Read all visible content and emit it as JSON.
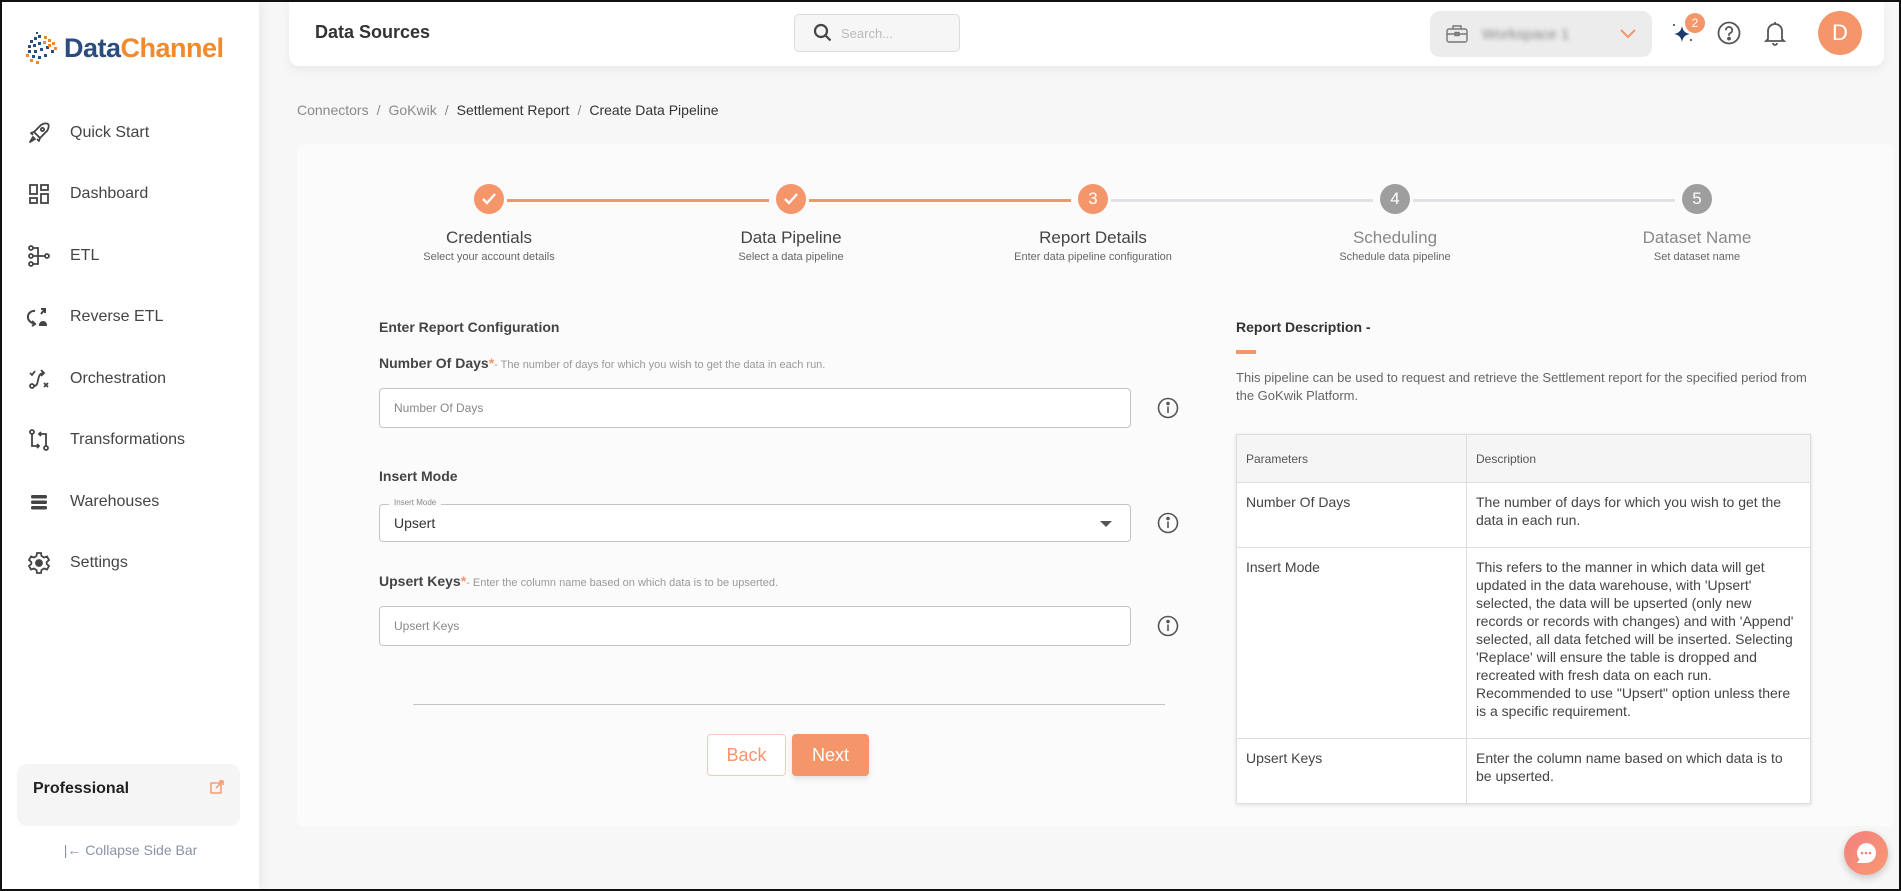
{
  "brand": {
    "part1": "Data",
    "part2": "Channel",
    "primary_color": "#2b4c7e",
    "accent_color": "#f08a2c"
  },
  "theme": {
    "accent": "#f4956a",
    "pending": "#9e9e9e"
  },
  "sidebar": {
    "items": [
      {
        "label": "Quick Start",
        "icon": "rocket-icon"
      },
      {
        "label": "Dashboard",
        "icon": "dashboard-icon"
      },
      {
        "label": "ETL",
        "icon": "etl-icon"
      },
      {
        "label": "Reverse ETL",
        "icon": "reverse-etl-icon"
      },
      {
        "label": "Orchestration",
        "icon": "orchestration-icon"
      },
      {
        "label": "Transformations",
        "icon": "transformations-icon"
      },
      {
        "label": "Warehouses",
        "icon": "warehouses-icon"
      },
      {
        "label": "Settings",
        "icon": "gear-icon"
      }
    ],
    "plan": {
      "name": "Professional",
      "icon": "external-link-icon"
    },
    "collapse_label": "Collapse Side Bar"
  },
  "header": {
    "title": "Data Sources",
    "search_placeholder": "Search...",
    "workspace_name": "Workspace 1",
    "notification_badge": "2",
    "avatar_initial": "D"
  },
  "breadcrumb": [
    {
      "label": "Connectors"
    },
    {
      "label": "GoKwik"
    },
    {
      "label": "Settlement Report"
    },
    {
      "label": "Create Data Pipeline"
    }
  ],
  "stepper": {
    "current_step": 3,
    "steps": [
      {
        "number": "1",
        "title": "Credentials",
        "subtitle": "Select your account details",
        "status": "done"
      },
      {
        "number": "2",
        "title": "Data Pipeline",
        "subtitle": "Select a data pipeline",
        "status": "done"
      },
      {
        "number": "3",
        "title": "Report Details",
        "subtitle": "Enter data pipeline configuration",
        "status": "active"
      },
      {
        "number": "4",
        "title": "Scheduling",
        "subtitle": "Schedule data pipeline",
        "status": "pending"
      },
      {
        "number": "5",
        "title": "Dataset Name",
        "subtitle": "Set dataset name",
        "status": "pending"
      }
    ]
  },
  "form": {
    "section_title": "Enter Report Configuration",
    "number_of_days": {
      "label": "Number Of Days",
      "required_mark": "*",
      "hint": "- The number of days for which you wish to get the data in each run.",
      "placeholder": "Number Of Days",
      "value": ""
    },
    "insert_mode": {
      "label": "Insert Mode",
      "legend": "Insert Mode",
      "value": "Upsert"
    },
    "upsert_keys": {
      "label": "Upsert Keys",
      "required_mark": "*",
      "hint": "- Enter the column name based on which data is to be upserted.",
      "placeholder": "Upsert Keys",
      "value": ""
    },
    "back_label": "Back",
    "next_label": "Next"
  },
  "report_description": {
    "title": "Report Description -",
    "text": "This pipeline can be used to request and retrieve the Settlement report for the specified period from the GoKwik Platform.",
    "table": {
      "headers": [
        "Parameters",
        "Description"
      ],
      "rows": [
        [
          "Number Of Days",
          "The number of days for which you wish to get the data in each run."
        ],
        [
          "Insert Mode",
          "This refers to the manner in which data will get updated in the data warehouse, with 'Upsert' selected, the data will be upserted (only new records or records with changes) and with 'Append' selected, all data fetched will be inserted. Selecting 'Replace' will ensure the table is dropped and recreated with fresh data on each run. Recommended to use \"Upsert\" option unless there is a specific requirement."
        ],
        [
          "Upsert Keys",
          "Enter the column name based on which data is to be upserted."
        ]
      ]
    }
  }
}
